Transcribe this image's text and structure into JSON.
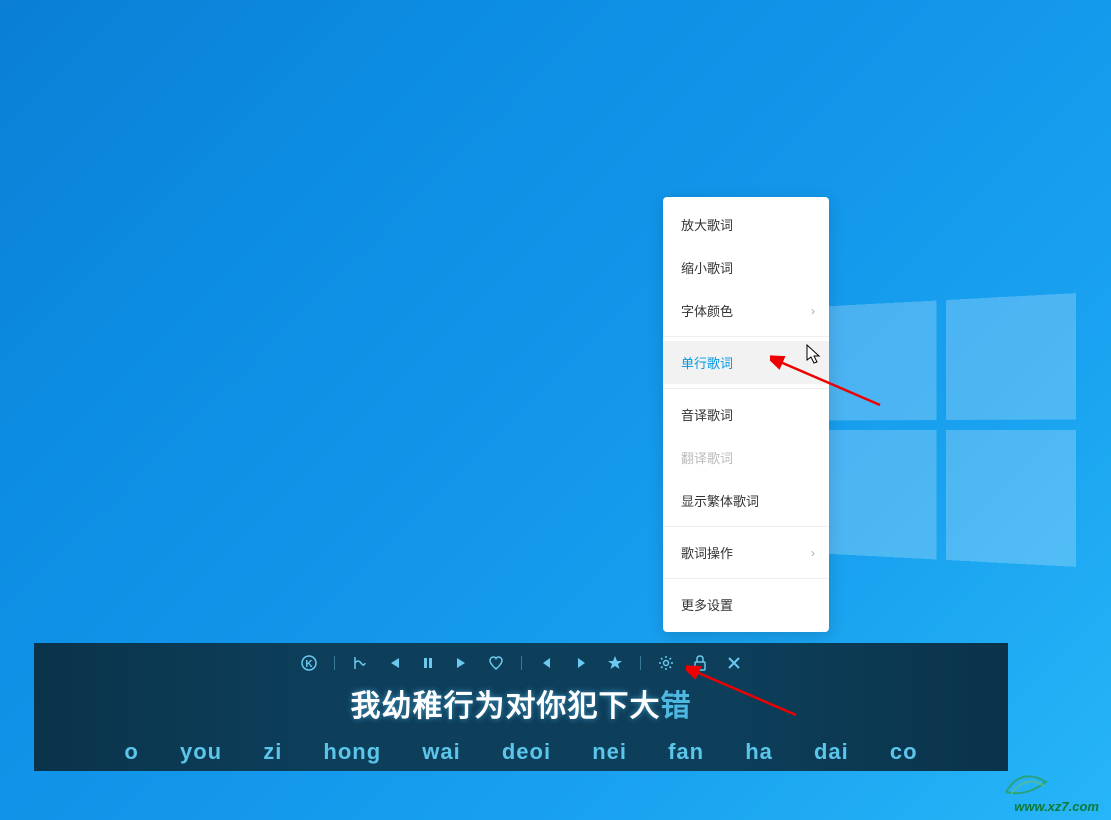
{
  "contextMenu": {
    "items": [
      {
        "label": "放大歌词",
        "hasSubmenu": false,
        "highlighted": false,
        "disabled": false
      },
      {
        "label": "缩小歌词",
        "hasSubmenu": false,
        "highlighted": false,
        "disabled": false
      },
      {
        "label": "字体颜色",
        "hasSubmenu": true,
        "highlighted": false,
        "disabled": false
      },
      {
        "label": "单行歌词",
        "hasSubmenu": false,
        "highlighted": true,
        "disabled": false
      },
      {
        "label": "音译歌词",
        "hasSubmenu": false,
        "highlighted": false,
        "disabled": false
      },
      {
        "label": "翻译歌词",
        "hasSubmenu": false,
        "highlighted": false,
        "disabled": true
      },
      {
        "label": "显示繁体歌词",
        "hasSubmenu": false,
        "highlighted": false,
        "disabled": false
      },
      {
        "label": "歌词操作",
        "hasSubmenu": true,
        "highlighted": false,
        "disabled": false
      },
      {
        "label": "更多设置",
        "hasSubmenu": false,
        "highlighted": false,
        "disabled": false
      }
    ]
  },
  "lyrics": {
    "sung": "我幼稚行为对你犯下大",
    "unsung": "错",
    "pinyin": "o you zi hong wai deoi nei fan ha dai co"
  },
  "toolbarIcons": {
    "brand": "K",
    "karaoke": "karaoke",
    "prev": "previous",
    "pause": "pause",
    "next": "next",
    "like": "like",
    "left": "left",
    "right": "right",
    "star": "star",
    "settings": "settings",
    "lock": "lock",
    "close": "close"
  },
  "watermark": "www.xz7.com"
}
